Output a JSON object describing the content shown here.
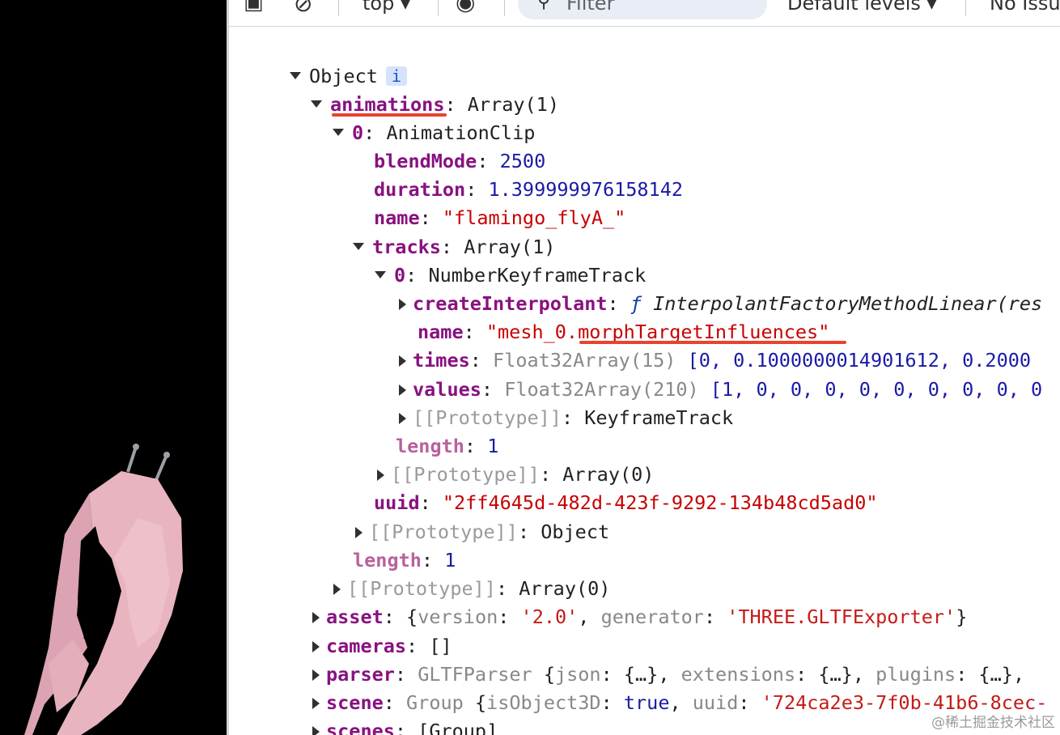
{
  "toolbar": {
    "context": "top",
    "filter_placeholder": "Filter",
    "levels": "Default levels",
    "issues": "No Issu"
  },
  "tree": {
    "root": "Object",
    "info_badge": "i",
    "animations_key": "animations",
    "animations_val": "Array(1)",
    "item0_index": "0",
    "item0_type": "AnimationClip",
    "blendMode_key": "blendMode",
    "blendMode_val": "2500",
    "duration_key": "duration",
    "duration_val": "1.399999976158142",
    "name_key": "name",
    "name_val": "\"flamingo_flyA_\"",
    "tracks_key": "tracks",
    "tracks_val": "Array(1)",
    "track0_index": "0",
    "track0_type": "NumberKeyframeTrack",
    "createInterpolant_key": "createInterpolant",
    "createInterpolant_f": "ƒ",
    "createInterpolant_val": "InterpolantFactoryMethodLinear(res",
    "track_name_key": "name",
    "track_name_val": "\"mesh_0.morphTargetInfluences\"",
    "times_key": "times",
    "times_type": "Float32Array(15)",
    "times_preview": "[0, 0.1000000014901612, 0.2000",
    "values_key": "values",
    "values_type": "Float32Array(210)",
    "values_preview": "[1, 0, 0, 0, 0, 0, 0, 0, 0, 0",
    "proto_keyframe_key": "[[Prototype]]",
    "proto_keyframe_val": "KeyframeTrack",
    "tracks_length_key": "length",
    "tracks_length_val": "1",
    "proto_tracks_key": "[[Prototype]]",
    "proto_tracks_val": "Array(0)",
    "uuid_key": "uuid",
    "uuid_val": "\"2ff4645d-482d-423f-9292-134b48cd5ad0\"",
    "proto_clip_key": "[[Prototype]]",
    "proto_clip_val": "Object",
    "anim_length_key": "length",
    "anim_length_val": "1",
    "proto_anim_key": "[[Prototype]]",
    "proto_anim_val": "Array(0)",
    "asset_key": "asset",
    "asset_open": "{",
    "asset_version_key": "version",
    "asset_version_val": "'2.0'",
    "asset_generator_key": "generator",
    "asset_generator_val": "'THREE.GLTFExporter'",
    "asset_close": "}",
    "cameras_key": "cameras",
    "cameras_val": "[]",
    "parser_key": "parser",
    "parser_type": "GLTFParser",
    "parser_json_key": "json",
    "parser_ext_key": "extensions",
    "parser_plugins_key": "plugins",
    "ellipsis_obj": "{…}",
    "scene_key": "scene",
    "scene_type": "Group",
    "scene_isobj_key": "isObject3D",
    "scene_isobj_val": "true",
    "scene_uuid_key": "uuid",
    "scene_uuid_val": "'724ca2e3-7f0b-41b6-8cec-",
    "scenes_key": "scenes",
    "scenes_val": "[Group]"
  },
  "watermark": "@稀土掘金技术社区",
  "colors": {
    "key": "#881280",
    "number": "#1a1aa6",
    "string": "#c80000",
    "annotation_underline": "#e8432e",
    "flamingo": "#e8b4c0"
  }
}
